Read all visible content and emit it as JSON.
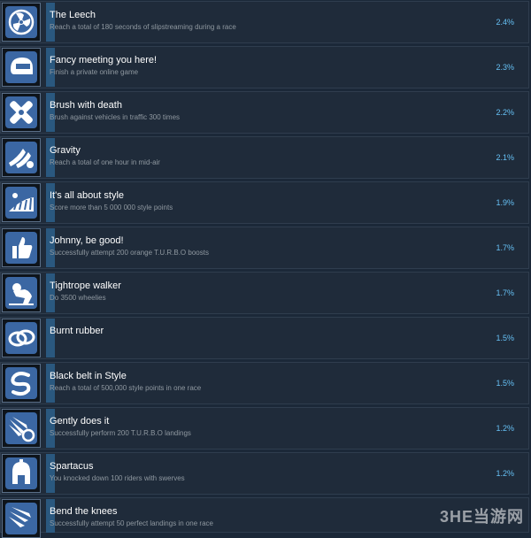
{
  "achievements": [
    {
      "title": "The Leech",
      "description": "Reach a total of 180 seconds of slipstreaming during a race",
      "percent": "2.4%",
      "icon": "fan-icon"
    },
    {
      "title": "Fancy meeting you here!",
      "description": "Finish a private online game",
      "percent": "2.3%",
      "icon": "helmet-icon"
    },
    {
      "title": "Brush with death",
      "description": "Brush against vehicles in traffic 300 times",
      "percent": "2.2%",
      "icon": "crossed-bandage-icon"
    },
    {
      "title": "Gravity",
      "description": "Reach a total of one hour in mid-air",
      "percent": "2.1%",
      "icon": "winged-rider-icon"
    },
    {
      "title": "It's all about style",
      "description": "Score more than 5 000 000 style points",
      "percent": "1.9%",
      "icon": "ramp-icon"
    },
    {
      "title": "Johnny, be good!",
      "description": "Successfully attempt 200 orange T.U.R.B.O boosts",
      "percent": "1.7%",
      "icon": "thumbs-up-icon"
    },
    {
      "title": "Tightrope walker",
      "description": "Do 3500 wheelies",
      "percent": "1.7%",
      "icon": "wheelie-icon"
    },
    {
      "title": "Burnt rubber",
      "description": "",
      "percent": "1.5%",
      "icon": "tire-icon"
    },
    {
      "title": "Black belt in Style",
      "description": "Reach a total of 500,000 style points in one race",
      "percent": "1.5%",
      "icon": "swirl-icon"
    },
    {
      "title": "Gently does it",
      "description": "Successfully perform 200 T.U.R.B.O landings",
      "percent": "1.2%",
      "icon": "winged-wheel-icon"
    },
    {
      "title": "Spartacus",
      "description": "You knocked down 100 riders with swerves",
      "percent": "1.2%",
      "icon": "spartan-helmet-icon"
    },
    {
      "title": "Bend the knees",
      "description": "Successfully attempt 50 perfect landings in one race",
      "percent": "",
      "icon": "wing-icon"
    }
  ],
  "watermark": "3HE当游网",
  "colors": {
    "background": "#1b2838",
    "row": "#1f2b3a",
    "icon_blue": "#3b67a3",
    "percent": "#66c0f4",
    "accent": "#2a587f"
  }
}
